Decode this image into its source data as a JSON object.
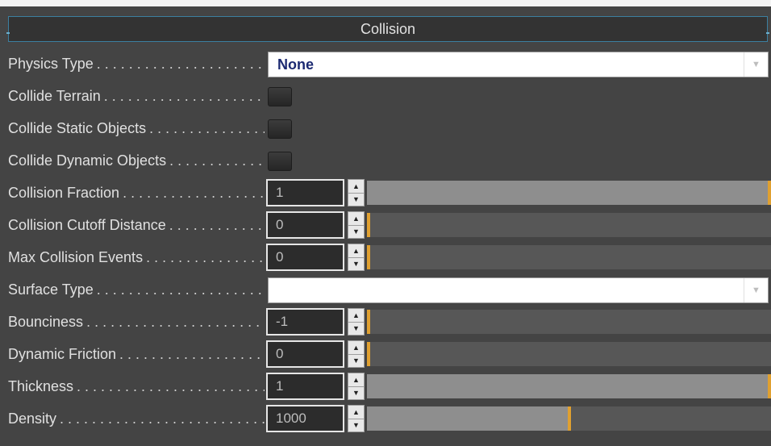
{
  "panel": {
    "title": "Collision"
  },
  "fields": {
    "physics_type": {
      "label": "Physics Type",
      "value": "None"
    },
    "collide_terrain": {
      "label": "Collide Terrain",
      "checked": false
    },
    "collide_static": {
      "label": "Collide Static Objects",
      "checked": false
    },
    "collide_dynamic": {
      "label": "Collide Dynamic Objects",
      "checked": false
    },
    "collision_fraction": {
      "label": "Collision Fraction",
      "value": "1",
      "slider_fraction": 1.0
    },
    "collision_cutoff": {
      "label": "Collision Cutoff Distance",
      "value": "0",
      "slider_fraction": 0.0
    },
    "max_collision_events": {
      "label": "Max Collision Events",
      "value": "0",
      "slider_fraction": 0.0
    },
    "surface_type": {
      "label": "Surface Type",
      "value": ""
    },
    "bounciness": {
      "label": "Bounciness",
      "value": "-1",
      "slider_fraction": 0.0
    },
    "dynamic_friction": {
      "label": "Dynamic Friction",
      "value": "0",
      "slider_fraction": 0.0
    },
    "thickness": {
      "label": "Thickness",
      "value": "1",
      "slider_fraction": 1.0
    },
    "density": {
      "label": "Density",
      "value": "1000",
      "slider_fraction": 0.5
    }
  },
  "icons": {
    "dropdown": "chevron-down-icon",
    "spin_up": "arrow-up-icon",
    "spin_down": "arrow-down-icon"
  },
  "colors": {
    "background": "#444444",
    "accent_border": "#3b7fa0",
    "slider_handle": "#e0a030",
    "dropdown_value": "#1c2a72"
  }
}
